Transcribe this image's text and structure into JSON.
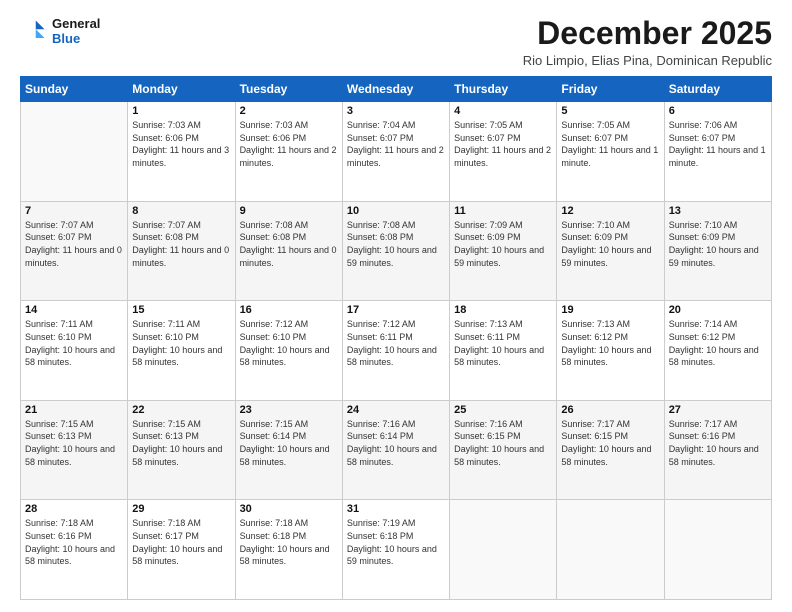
{
  "header": {
    "logo_line1": "General",
    "logo_line2": "Blue",
    "month": "December 2025",
    "location": "Rio Limpio, Elias Pina, Dominican Republic"
  },
  "weekdays": [
    "Sunday",
    "Monday",
    "Tuesday",
    "Wednesday",
    "Thursday",
    "Friday",
    "Saturday"
  ],
  "weeks": [
    [
      {
        "day": "",
        "sunrise": "",
        "sunset": "",
        "daylight": ""
      },
      {
        "day": "1",
        "sunrise": "Sunrise: 7:03 AM",
        "sunset": "Sunset: 6:06 PM",
        "daylight": "Daylight: 11 hours and 3 minutes."
      },
      {
        "day": "2",
        "sunrise": "Sunrise: 7:03 AM",
        "sunset": "Sunset: 6:06 PM",
        "daylight": "Daylight: 11 hours and 2 minutes."
      },
      {
        "day": "3",
        "sunrise": "Sunrise: 7:04 AM",
        "sunset": "Sunset: 6:07 PM",
        "daylight": "Daylight: 11 hours and 2 minutes."
      },
      {
        "day": "4",
        "sunrise": "Sunrise: 7:05 AM",
        "sunset": "Sunset: 6:07 PM",
        "daylight": "Daylight: 11 hours and 2 minutes."
      },
      {
        "day": "5",
        "sunrise": "Sunrise: 7:05 AM",
        "sunset": "Sunset: 6:07 PM",
        "daylight": "Daylight: 11 hours and 1 minute."
      },
      {
        "day": "6",
        "sunrise": "Sunrise: 7:06 AM",
        "sunset": "Sunset: 6:07 PM",
        "daylight": "Daylight: 11 hours and 1 minute."
      }
    ],
    [
      {
        "day": "7",
        "sunrise": "Sunrise: 7:07 AM",
        "sunset": "Sunset: 6:07 PM",
        "daylight": "Daylight: 11 hours and 0 minutes."
      },
      {
        "day": "8",
        "sunrise": "Sunrise: 7:07 AM",
        "sunset": "Sunset: 6:08 PM",
        "daylight": "Daylight: 11 hours and 0 minutes."
      },
      {
        "day": "9",
        "sunrise": "Sunrise: 7:08 AM",
        "sunset": "Sunset: 6:08 PM",
        "daylight": "Daylight: 11 hours and 0 minutes."
      },
      {
        "day": "10",
        "sunrise": "Sunrise: 7:08 AM",
        "sunset": "Sunset: 6:08 PM",
        "daylight": "Daylight: 10 hours and 59 minutes."
      },
      {
        "day": "11",
        "sunrise": "Sunrise: 7:09 AM",
        "sunset": "Sunset: 6:09 PM",
        "daylight": "Daylight: 10 hours and 59 minutes."
      },
      {
        "day": "12",
        "sunrise": "Sunrise: 7:10 AM",
        "sunset": "Sunset: 6:09 PM",
        "daylight": "Daylight: 10 hours and 59 minutes."
      },
      {
        "day": "13",
        "sunrise": "Sunrise: 7:10 AM",
        "sunset": "Sunset: 6:09 PM",
        "daylight": "Daylight: 10 hours and 59 minutes."
      }
    ],
    [
      {
        "day": "14",
        "sunrise": "Sunrise: 7:11 AM",
        "sunset": "Sunset: 6:10 PM",
        "daylight": "Daylight: 10 hours and 58 minutes."
      },
      {
        "day": "15",
        "sunrise": "Sunrise: 7:11 AM",
        "sunset": "Sunset: 6:10 PM",
        "daylight": "Daylight: 10 hours and 58 minutes."
      },
      {
        "day": "16",
        "sunrise": "Sunrise: 7:12 AM",
        "sunset": "Sunset: 6:10 PM",
        "daylight": "Daylight: 10 hours and 58 minutes."
      },
      {
        "day": "17",
        "sunrise": "Sunrise: 7:12 AM",
        "sunset": "Sunset: 6:11 PM",
        "daylight": "Daylight: 10 hours and 58 minutes."
      },
      {
        "day": "18",
        "sunrise": "Sunrise: 7:13 AM",
        "sunset": "Sunset: 6:11 PM",
        "daylight": "Daylight: 10 hours and 58 minutes."
      },
      {
        "day": "19",
        "sunrise": "Sunrise: 7:13 AM",
        "sunset": "Sunset: 6:12 PM",
        "daylight": "Daylight: 10 hours and 58 minutes."
      },
      {
        "day": "20",
        "sunrise": "Sunrise: 7:14 AM",
        "sunset": "Sunset: 6:12 PM",
        "daylight": "Daylight: 10 hours and 58 minutes."
      }
    ],
    [
      {
        "day": "21",
        "sunrise": "Sunrise: 7:15 AM",
        "sunset": "Sunset: 6:13 PM",
        "daylight": "Daylight: 10 hours and 58 minutes."
      },
      {
        "day": "22",
        "sunrise": "Sunrise: 7:15 AM",
        "sunset": "Sunset: 6:13 PM",
        "daylight": "Daylight: 10 hours and 58 minutes."
      },
      {
        "day": "23",
        "sunrise": "Sunrise: 7:15 AM",
        "sunset": "Sunset: 6:14 PM",
        "daylight": "Daylight: 10 hours and 58 minutes."
      },
      {
        "day": "24",
        "sunrise": "Sunrise: 7:16 AM",
        "sunset": "Sunset: 6:14 PM",
        "daylight": "Daylight: 10 hours and 58 minutes."
      },
      {
        "day": "25",
        "sunrise": "Sunrise: 7:16 AM",
        "sunset": "Sunset: 6:15 PM",
        "daylight": "Daylight: 10 hours and 58 minutes."
      },
      {
        "day": "26",
        "sunrise": "Sunrise: 7:17 AM",
        "sunset": "Sunset: 6:15 PM",
        "daylight": "Daylight: 10 hours and 58 minutes."
      },
      {
        "day": "27",
        "sunrise": "Sunrise: 7:17 AM",
        "sunset": "Sunset: 6:16 PM",
        "daylight": "Daylight: 10 hours and 58 minutes."
      }
    ],
    [
      {
        "day": "28",
        "sunrise": "Sunrise: 7:18 AM",
        "sunset": "Sunset: 6:16 PM",
        "daylight": "Daylight: 10 hours and 58 minutes."
      },
      {
        "day": "29",
        "sunrise": "Sunrise: 7:18 AM",
        "sunset": "Sunset: 6:17 PM",
        "daylight": "Daylight: 10 hours and 58 minutes."
      },
      {
        "day": "30",
        "sunrise": "Sunrise: 7:18 AM",
        "sunset": "Sunset: 6:18 PM",
        "daylight": "Daylight: 10 hours and 58 minutes."
      },
      {
        "day": "31",
        "sunrise": "Sunrise: 7:19 AM",
        "sunset": "Sunset: 6:18 PM",
        "daylight": "Daylight: 10 hours and 59 minutes."
      },
      {
        "day": "",
        "sunrise": "",
        "sunset": "",
        "daylight": ""
      },
      {
        "day": "",
        "sunrise": "",
        "sunset": "",
        "daylight": ""
      },
      {
        "day": "",
        "sunrise": "",
        "sunset": "",
        "daylight": ""
      }
    ]
  ]
}
